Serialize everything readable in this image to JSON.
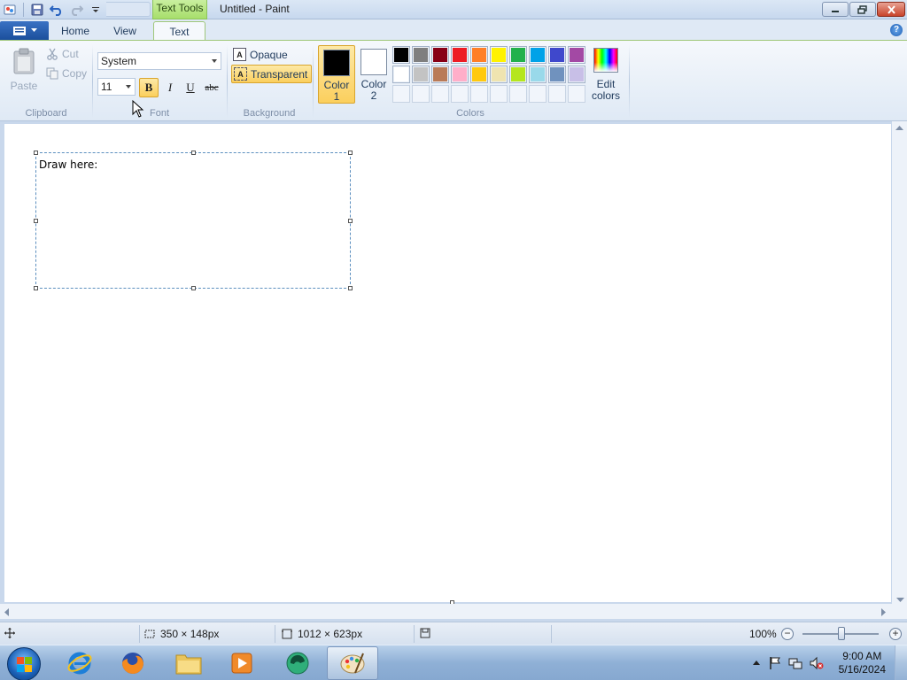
{
  "window": {
    "title": "Untitled - Paint",
    "context_tab": "Text Tools"
  },
  "tabs": [
    {
      "label": "Home"
    },
    {
      "label": "View"
    },
    {
      "label": "Text",
      "active": true
    }
  ],
  "help_glyph": "?",
  "clipboard": {
    "paste": "Paste",
    "cut": "Cut",
    "copy": "Copy",
    "group_label": "Clipboard"
  },
  "font": {
    "family": "System",
    "size": "11",
    "bold": "B",
    "italic": "I",
    "underline": "U",
    "strikethrough": "abc",
    "bold_active": true,
    "group_label": "Font"
  },
  "background": {
    "opaque": "Opaque",
    "transparent": "Transparent",
    "icon_glyph": "A",
    "selected": "Transparent",
    "group_label": "Background"
  },
  "colors": {
    "color1_label": "Color 1",
    "color1_line1": "Color",
    "color1_line2": "1",
    "color2_line1": "Color",
    "color2_line2": "2",
    "color1_value": "#000000",
    "color2_value": "#ffffff",
    "edit_line1": "Edit",
    "edit_line2": "colors",
    "group_label": "Colors",
    "palette": [
      "#000000",
      "#7f7f7f",
      "#880015",
      "#ed1c24",
      "#ff7f27",
      "#fff200",
      "#22b14c",
      "#00a2e8",
      "#3f48cc",
      "#a349a4",
      "#ffffff",
      "#c3c3c3",
      "#b97a57",
      "#ffaec9",
      "#ffc90e",
      "#efe4b0",
      "#b5e61d",
      "#99d9ea",
      "#7092be",
      "#c8bfe7",
      "",
      "",
      "",
      "",
      "",
      "",
      "",
      "",
      "",
      ""
    ]
  },
  "canvas": {
    "text": "Draw here:"
  },
  "status": {
    "selection_size": "350 × 148px",
    "canvas_size": "1012 × 623px",
    "zoom": "100%",
    "zoom_out": "−",
    "zoom_in": "+"
  },
  "taskbar": {
    "time": "9:00 AM",
    "date": "5/16/2024",
    "apps": [
      "internet-explorer",
      "firefox",
      "file-explorer",
      "media-player",
      "app-green",
      "paint"
    ]
  }
}
